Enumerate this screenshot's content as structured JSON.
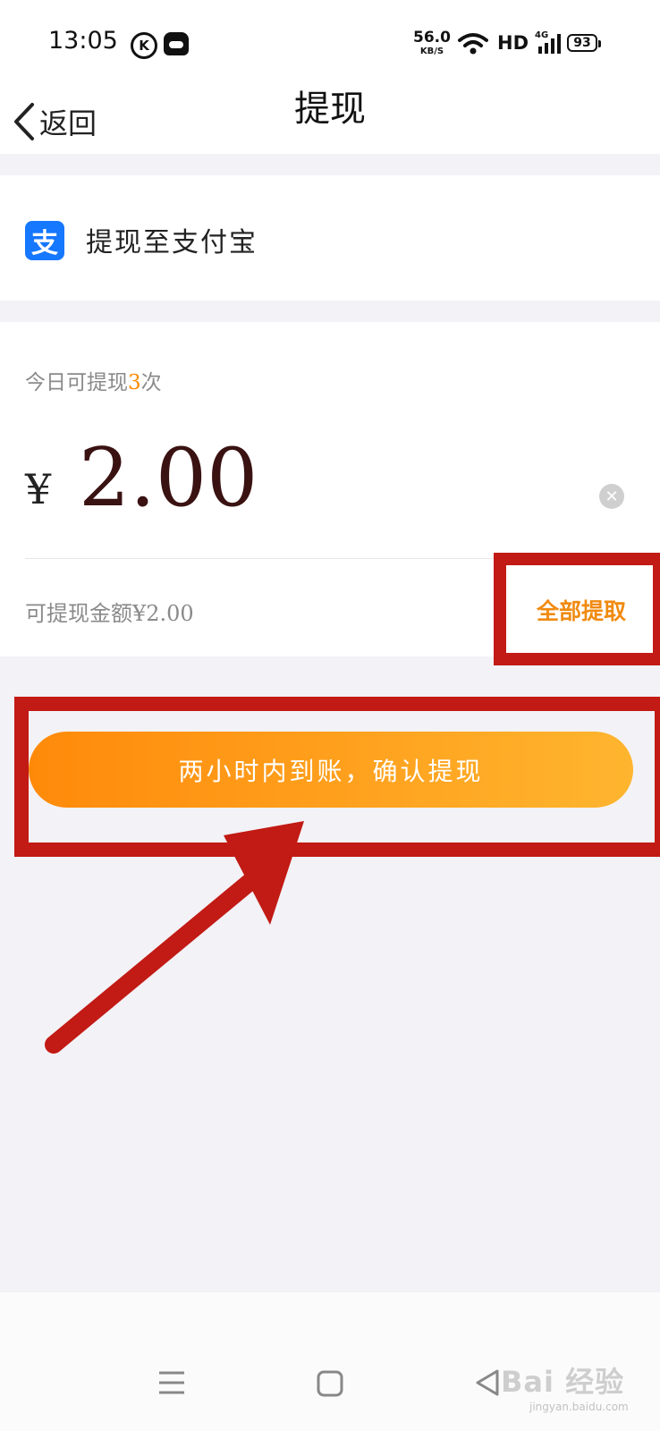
{
  "status": {
    "time": "13:05",
    "k_badge": "K",
    "speed_value": "56.0",
    "speed_unit": "KB/S",
    "hd": "HD",
    "network": "4G",
    "battery": "93"
  },
  "nav": {
    "back_label": "返回",
    "title": "提现"
  },
  "payout": {
    "method_icon": "支",
    "method_label": "提现至支付宝"
  },
  "amount": {
    "limit_prefix": "今日可提现",
    "limit_count": "3",
    "limit_suffix": "次",
    "currency": "¥",
    "value": "2.00",
    "available_label": "可提现金额¥2.00",
    "withdraw_all_label": "全部提取"
  },
  "confirm": {
    "label": "两小时内到账，确认提现"
  },
  "watermark": {
    "main": "Bai 经验",
    "sub": "jingyan.baidu.com"
  },
  "colors": {
    "accent_orange": "#f08a10",
    "button_gradient_start": "#ff8a0a",
    "button_gradient_end": "#ffb52f",
    "annotation_red": "#c21a14",
    "alipay_blue": "#1677ff"
  }
}
